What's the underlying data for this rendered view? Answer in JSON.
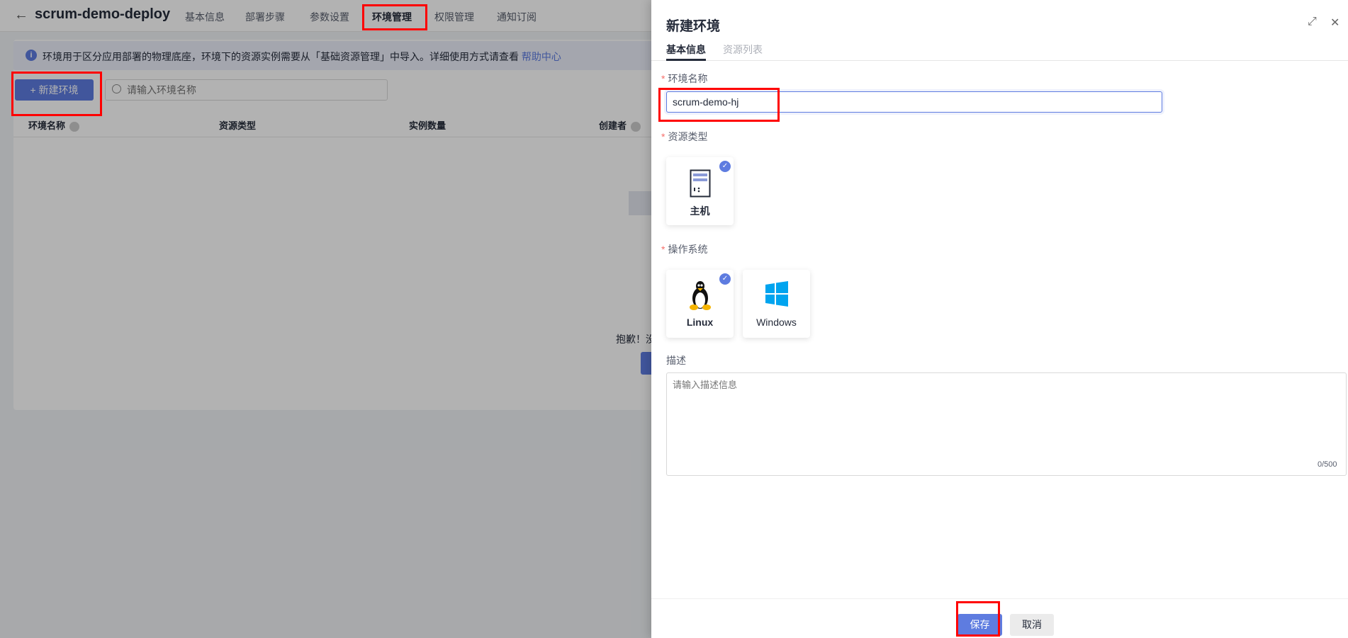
{
  "header": {
    "title": "scrum-demo-deploy",
    "tabs": [
      {
        "label": "基本信息"
      },
      {
        "label": "部署步骤"
      },
      {
        "label": "参数设置"
      },
      {
        "label": "环境管理",
        "active": true
      },
      {
        "label": "权限管理"
      },
      {
        "label": "通知订阅"
      }
    ]
  },
  "info": {
    "text": "环境用于区分应用部署的物理底座，环境下的资源实例需要从「基础资源管理」中导入。详细使用方式请查看 ",
    "link": "帮助中心"
  },
  "toolbar": {
    "new_label": "+ 新建环境",
    "search_placeholder": "请输入环境名称"
  },
  "table": {
    "columns": [
      "环境名称",
      "资源类型",
      "实例数量",
      "创建者"
    ]
  },
  "empty": {
    "text": "抱歉！没"
  },
  "drawer": {
    "title": "新建环境",
    "tabs": [
      "基本信息",
      "资源列表"
    ],
    "name_label": "环境名称",
    "name_value": "scrum-demo-hj",
    "resource_label": "资源类型",
    "resource_options": [
      {
        "label": "主机",
        "selected": true
      }
    ],
    "os_label": "操作系统",
    "os_options": [
      {
        "label": "Linux",
        "selected": true
      },
      {
        "label": "Windows",
        "selected": false
      }
    ],
    "desc_label": "描述",
    "desc_placeholder": "请输入描述信息",
    "desc_count": "0/500",
    "save": "保存",
    "cancel": "取消"
  },
  "colors": {
    "accent": "#5e7ce0",
    "required": "#f66f6a",
    "annotation": "#ff0000"
  }
}
